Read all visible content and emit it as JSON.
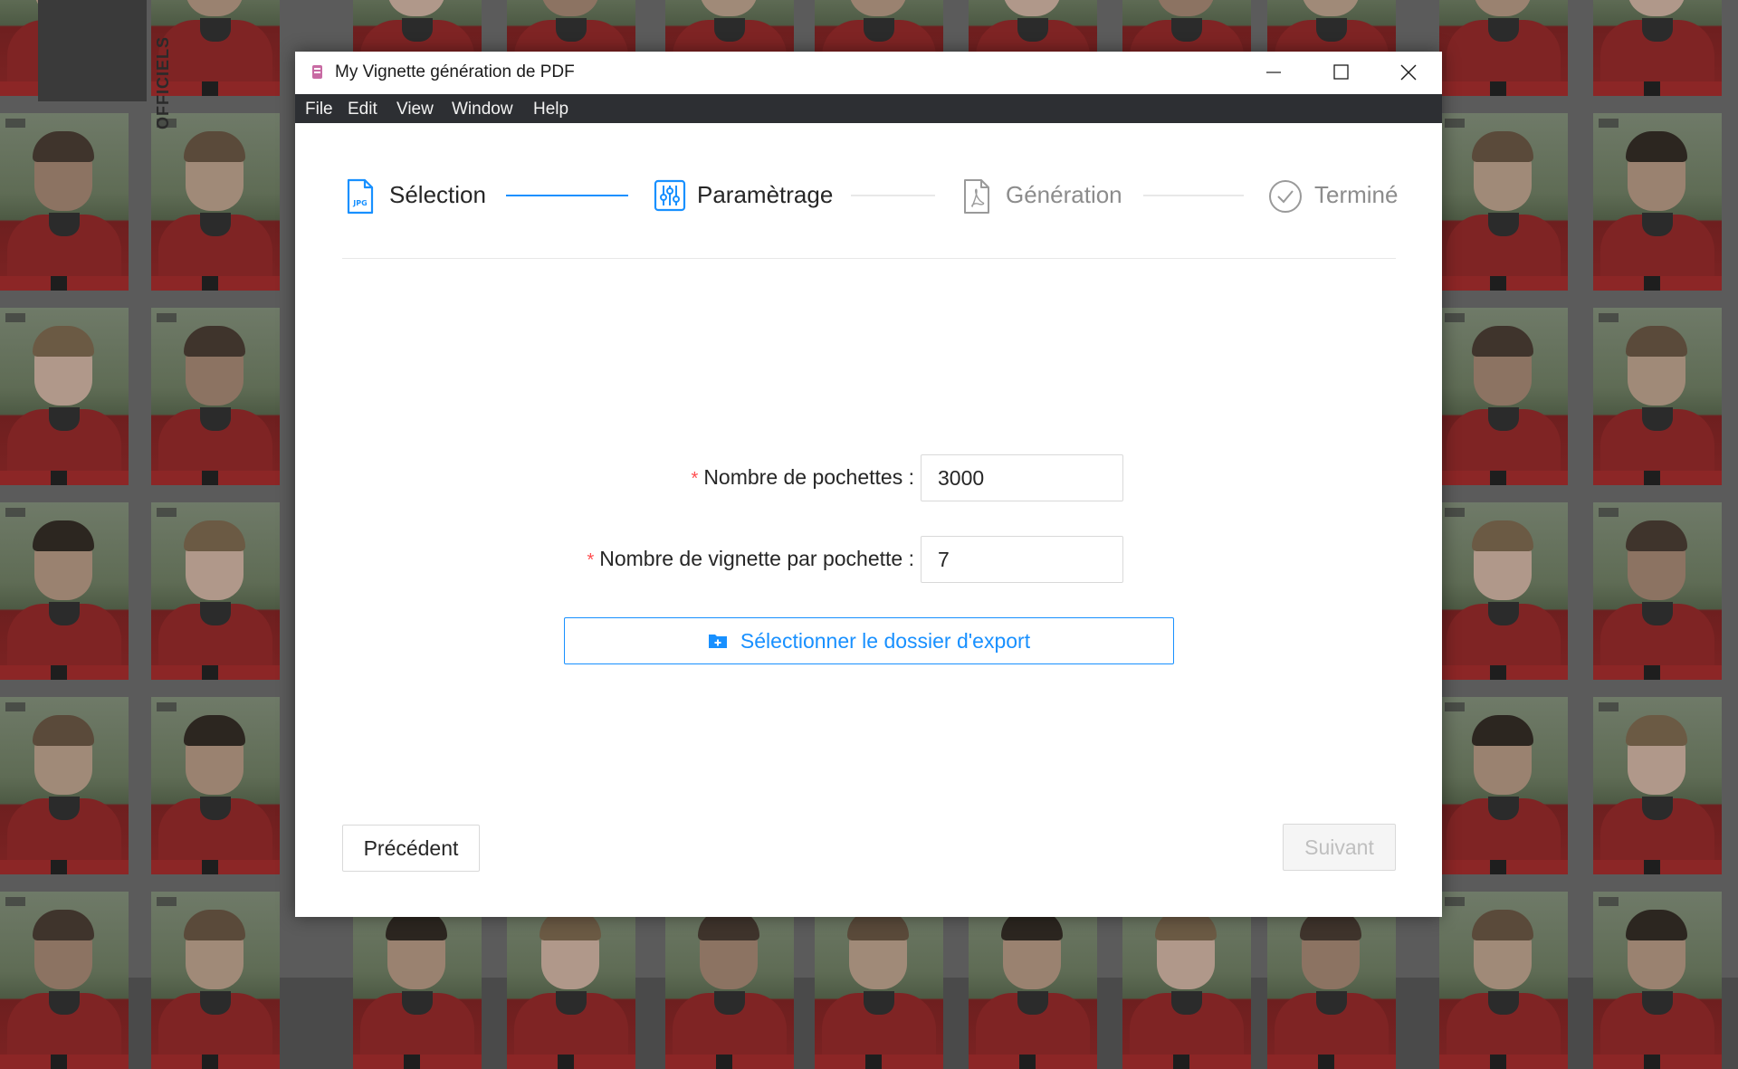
{
  "window": {
    "title": "My Vignette génération de PDF"
  },
  "menu": [
    "File",
    "Edit",
    "View",
    "Window",
    "Help"
  ],
  "wallpaper": {
    "side_label": "OFFICIELS"
  },
  "steps": [
    {
      "label": "Sélection",
      "icon": "jpg-file-icon",
      "status": "finished"
    },
    {
      "label": "Paramètrage",
      "icon": "sliders-icon",
      "status": "current"
    },
    {
      "label": "Génération",
      "icon": "pdf-file-icon",
      "status": "waiting"
    },
    {
      "label": "Terminé",
      "icon": "check-circle-icon",
      "status": "waiting"
    }
  ],
  "form": {
    "pochettes": {
      "label": "Nombre de pochettes",
      "required": "*",
      "value": "3000"
    },
    "vignettes": {
      "label": "Nombre de vignette par pochette",
      "required": "*",
      "value": "7"
    },
    "export_button": "Sélectionner le dossier d'export"
  },
  "footer": {
    "prev_label": "Précédent",
    "next_label": "Suivant"
  },
  "colors": {
    "accent": "#1890ff",
    "menubar": "#2d2f33",
    "step_active": "#262626",
    "step_waiting": "#8c8c8c",
    "required_mark": "#ff4d4f",
    "disabled_text": "#bfbfbf"
  }
}
